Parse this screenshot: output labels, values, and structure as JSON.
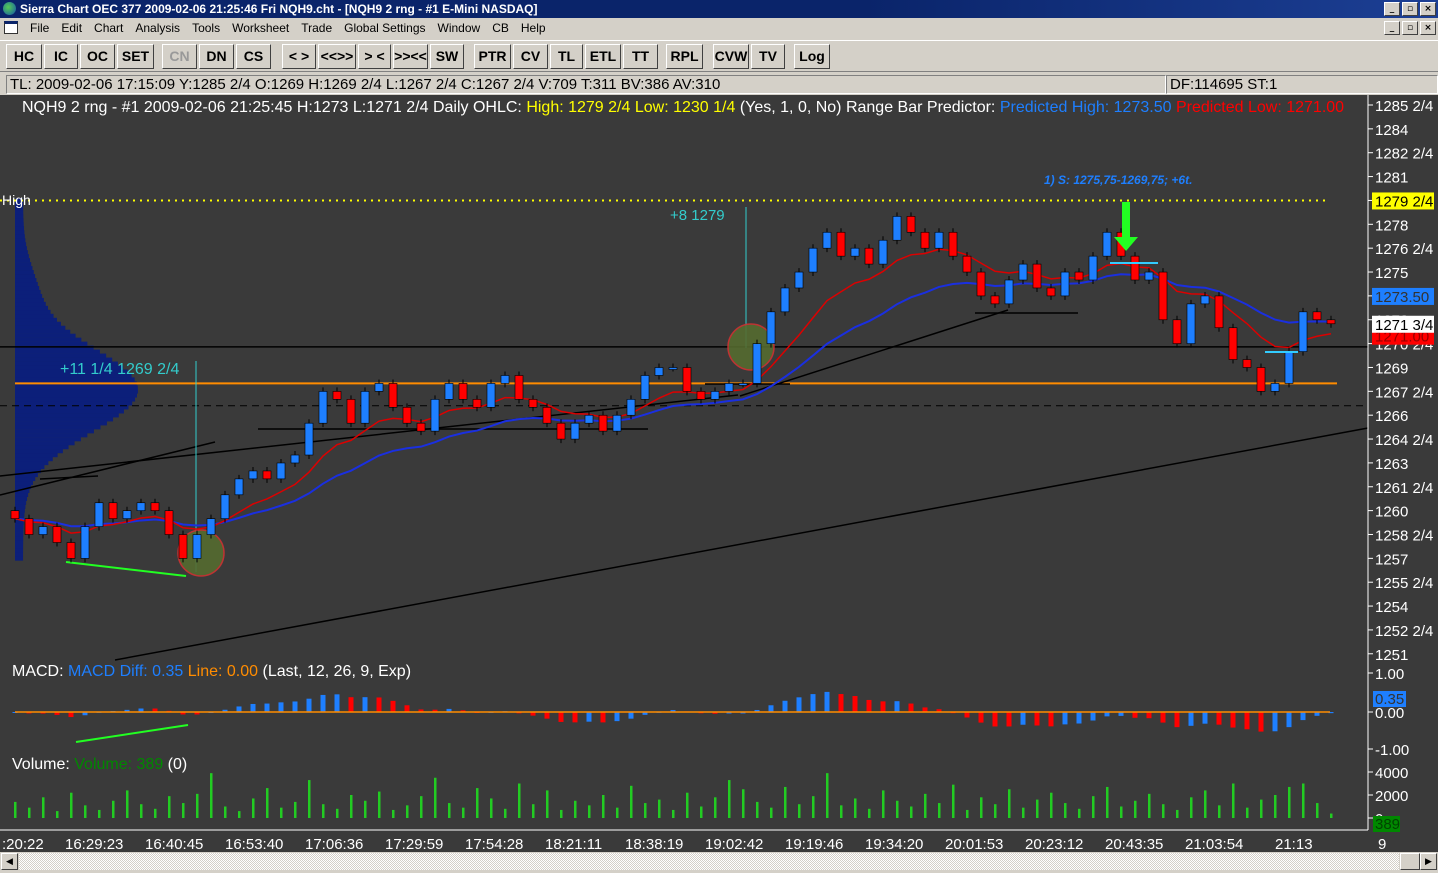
{
  "window": {
    "title": "Sierra Chart OEC 377  2009-02-06  21:25:46  Fri   NQH9.cht - [NQH9  2 rng - #1 E-Mini NASDAQ]"
  },
  "menu": [
    "File",
    "Edit",
    "Chart",
    "Analysis",
    "Tools",
    "Worksheet",
    "Trade",
    "Global Settings",
    "Window",
    "CB",
    "Help"
  ],
  "toolbar": [
    "HC",
    "IC",
    "OC",
    "SET",
    "CN",
    "DN",
    "CS",
    "< >",
    "<<>>",
    "> <",
    ">><<",
    "SW",
    "PTR",
    "CV",
    "TL",
    "ETL",
    "TT",
    "RPL",
    "CVW",
    "TV",
    "Log"
  ],
  "infobar": {
    "main": "TL: 2009-02-06  17:15:09  Y:1285 2/4   O:1269  H:1269 2/4  L:1267 2/4  C:1267 2/4  V:709  T:311  BV:386  AV:310",
    "right": "DF:114695  ST:1"
  },
  "header": {
    "symbol": "NQH9  2 rng - #1  2009-02-06  21:25:45  H:1273  L:1271 2/4  Daily OHLC:",
    "daily_high": "High: 1279 2/4",
    "daily_low": "Low: 1230 1/4",
    "params": "(Yes, 1, 0, No)  Range Bar Predictor:",
    "pred_high": "Predicted High: 1273.50",
    "pred_low": "Predicted Low: 1271.00"
  },
  "annotations": {
    "trade": "1) S: 1275,75-1269,75; +6t.",
    "high_label": "High",
    "move1": "+11 1/4  1269 2/4",
    "move2": "+8  1279"
  },
  "macd": {
    "label": "MACD:",
    "diff": "MACD Diff: 0.35",
    "line": "Line: 0.00",
    "params": "(Last, 12, 26, 9, Exp)",
    "axis": [
      "1.00",
      "0.00",
      "-1.00"
    ],
    "current": "0.35"
  },
  "volume": {
    "label": "Volume:",
    "value": "Volume: 389",
    "params": "(0)",
    "axis": [
      "4000",
      "2000",
      "0"
    ],
    "current": "389"
  },
  "price_axis": [
    "1285 2/4",
    "1284",
    "1282 2/4",
    "1281",
    "1279 2/4",
    "1278",
    "1276 2/4",
    "1275",
    "1273 2/4",
    "1272",
    "1270 2/4",
    "1269",
    "1267 2/4",
    "1266",
    "1264 2/4",
    "1263",
    "1261 2/4",
    "1260",
    "1258 2/4",
    "1257",
    "1255 2/4",
    "1254",
    "1252 2/4",
    "1251"
  ],
  "price_markers": {
    "daily_high": "1279 2/4",
    "pred_high": "1273.50",
    "last": "1271 3/4",
    "pred_low": "1271.00"
  },
  "time_axis": [
    ":20:22",
    "16:29:23",
    "16:40:45",
    "16:53:40",
    "17:06:36",
    "17:29:59",
    "17:54:28",
    "18:21:11",
    "18:38:19",
    "19:02:42",
    "19:19:46",
    "19:34:20",
    "20:01:53",
    "20:23:12",
    "20:43:35",
    "21:03:54",
    "21:13"
  ],
  "time_axis_extra": "9",
  "colors": {
    "up": "#1e7fff",
    "down": "#ff0000",
    "bg": "#3a3a3a",
    "yellow": "#ffff00",
    "orange": "#ff8c00"
  },
  "chart_data": {
    "type": "candlestick",
    "ylim": [
      1251,
      1285.5
    ],
    "closes": [
      1259.5,
      1258.5,
      1259,
      1258,
      1257,
      1259,
      1260.5,
      1259.5,
      1260,
      1260.5,
      1260,
      1258.5,
      1257,
      1258.5,
      1259.5,
      1261,
      1262,
      1262.5,
      1262,
      1263,
      1263.5,
      1265.5,
      1267.5,
      1267,
      1265.5,
      1267.5,
      1268,
      1266.5,
      1265.5,
      1265,
      1267,
      1268,
      1267,
      1266.5,
      1268,
      1268.5,
      1267,
      1266.5,
      1265.5,
      1264.5,
      1265.5,
      1266,
      1265,
      1266,
      1267,
      1268.5,
      1269,
      1269,
      1267.5,
      1267,
      1267.5,
      1268,
      1268,
      1270.5,
      1272.5,
      1274,
      1275,
      1276.5,
      1277.5,
      1276,
      1276.5,
      1275.5,
      1277,
      1278.5,
      1277.5,
      1276.5,
      1277.5,
      1276,
      1275,
      1273.5,
      1273,
      1274.5,
      1275.5,
      1274,
      1273.5,
      1275,
      1274.5,
      1276,
      1277.5,
      1276,
      1274.5,
      1275,
      1272,
      1270.5,
      1273,
      1273.5,
      1271.5,
      1269.5,
      1269,
      1267.5,
      1268,
      1270,
      1272.5,
      1272,
      1271.75
    ],
    "volumes": [
      1400,
      900,
      1800,
      600,
      2200,
      1100,
      700,
      1500,
      2400,
      1200,
      800,
      1900,
      1300,
      2100,
      3900,
      1000,
      600,
      1700,
      2600,
      900,
      1400,
      3300,
      1200,
      800,
      2000,
      1500,
      2300,
      700,
      1100,
      1900,
      3500,
      1300,
      900,
      2600,
      1700,
      800,
      3000,
      1200,
      2400,
      700,
      1500,
      1100,
      2000,
      900,
      2800,
      1300,
      1600,
      700,
      2200,
      1000,
      1800,
      3300,
      2500,
      1400,
      900,
      2700,
      1200,
      1900,
      3900,
      1100,
      1700,
      800,
      2400,
      1500,
      1000,
      2100,
      1300,
      2900,
      700,
      1800,
      1200,
      2500,
      900,
      1600,
      2200,
      1300,
      800,
      1900,
      2700,
      1000,
      1500,
      2100,
      1200,
      700,
      1800,
      2400,
      1100,
      3000,
      900,
      1600,
      2000,
      2700,
      3000,
      1300,
      389
    ]
  }
}
